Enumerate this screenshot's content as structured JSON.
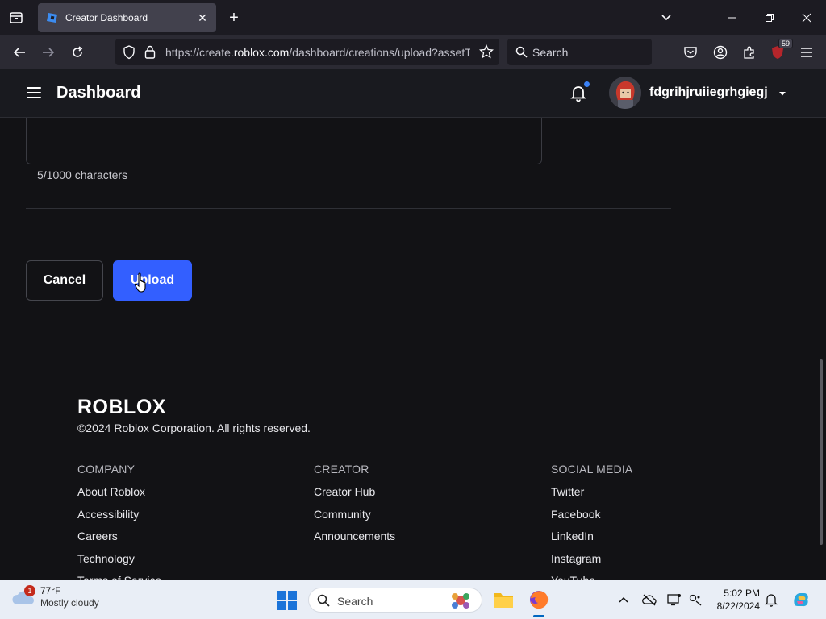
{
  "browser": {
    "tab_title": "Creator Dashboard",
    "url_prefix": "https://create.",
    "url_domain": "roblox.com",
    "url_path": "/dashboard/creations/upload?assetTy",
    "search_placeholder": "Search",
    "extension_badge": "59"
  },
  "header": {
    "title": "Dashboard",
    "username": "fdgrihjruiiegrhgiegj"
  },
  "form": {
    "char_count": "5/1000 characters",
    "cancel_label": "Cancel",
    "upload_label": "Upload"
  },
  "footer": {
    "logo_text": "ROBLOX",
    "copyright": "©2024 Roblox Corporation. All rights reserved.",
    "columns": [
      {
        "heading": "COMPANY",
        "links": [
          "About Roblox",
          "Accessibility",
          "Careers",
          "Technology",
          "Terms of Service"
        ]
      },
      {
        "heading": "CREATOR",
        "links": [
          "Creator Hub",
          "Community",
          "Announcements"
        ]
      },
      {
        "heading": "SOCIAL MEDIA",
        "links": [
          "Twitter",
          "Facebook",
          "LinkedIn",
          "Instagram",
          "YouTube"
        ]
      }
    ]
  },
  "taskbar": {
    "weather_temp": "77°F",
    "weather_condition": "Mostly cloudy",
    "weather_badge": "1",
    "search_placeholder": "Search",
    "time": "5:02 PM",
    "date": "8/22/2024"
  },
  "colors": {
    "accent_blue": "#335fff",
    "page_bg": "#121215",
    "header_bg": "#191a1f"
  }
}
